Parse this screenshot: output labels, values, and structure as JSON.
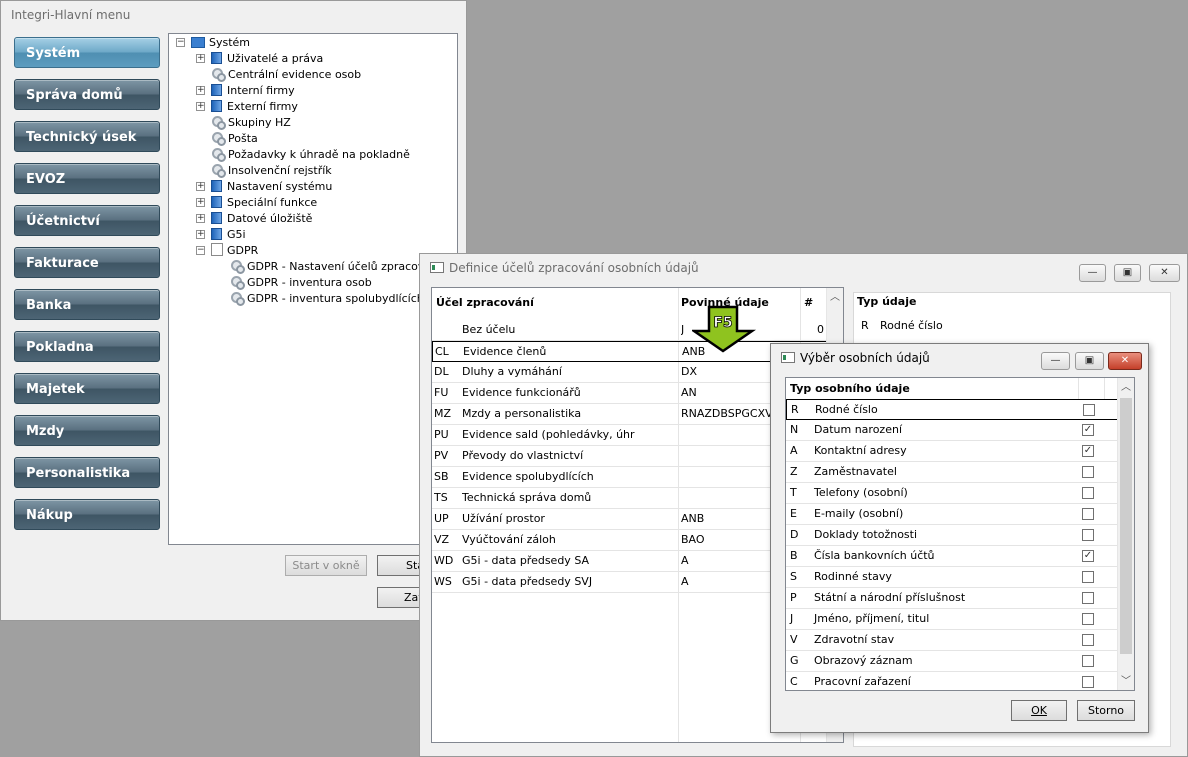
{
  "main_window": {
    "title": "Integri-Hlavní menu",
    "nav": [
      "Systém",
      "Správa domů",
      "Technický úsek",
      "EVOZ",
      "Účetnictví",
      "Fakturace",
      "Banka",
      "Pokladna",
      "Majetek",
      "Mzdy",
      "Personalistika",
      "Nákup"
    ],
    "tree": [
      {
        "label": "Systém",
        "icon": "folder-icon",
        "expander": "−"
      },
      {
        "label": "Uživatelé a práva",
        "icon": "book-icon",
        "expander": "+"
      },
      {
        "label": "Centrální evidence osob",
        "icon": "gear-icon",
        "expander": ""
      },
      {
        "label": "Interní firmy",
        "icon": "book-icon",
        "expander": "+"
      },
      {
        "label": "Externí firmy",
        "icon": "book-icon",
        "expander": "+"
      },
      {
        "label": "Skupiny HZ",
        "icon": "gear-icon",
        "expander": ""
      },
      {
        "label": "Pošta",
        "icon": "gear-icon",
        "expander": ""
      },
      {
        "label": "Požadavky k úhradě na pokladně",
        "icon": "gear-icon",
        "expander": ""
      },
      {
        "label": "Insolvenční rejstřík",
        "icon": "gear-icon",
        "expander": ""
      },
      {
        "label": "Nastavení systému",
        "icon": "book-icon",
        "expander": "+"
      },
      {
        "label": "Speciální funkce",
        "icon": "book-icon",
        "expander": "+"
      },
      {
        "label": "Datové úložiště",
        "icon": "book-icon",
        "expander": "+"
      },
      {
        "label": "G5i",
        "icon": "book-icon",
        "expander": "+"
      },
      {
        "label": "GDPR",
        "icon": "doc-icon",
        "expander": "−"
      },
      {
        "label": "GDPR - Nastavení účelů zpracování",
        "icon": "gear-icon",
        "expander": ""
      },
      {
        "label": "GDPR - inventura osob",
        "icon": "gear-icon",
        "expander": ""
      },
      {
        "label": "GDPR - inventura spolubydlících",
        "icon": "gear-icon",
        "expander": ""
      }
    ],
    "btn_start_okne": "Start v okně",
    "btn_start_partial": "Sta",
    "btn_zavrit_partial": "Zav"
  },
  "definice_window": {
    "title": "Definice účelů zpracování osobních údajů",
    "col_ucel": "Účel zpracování",
    "col_povinne": "Povinné údaje",
    "col_hash": "#",
    "rows": [
      {
        "code": "",
        "name": "Bez účelu",
        "req": "J",
        "count": "0"
      },
      {
        "code": "CL",
        "name": "Evidence členů",
        "req": "ANB",
        "count": ""
      },
      {
        "code": "DL",
        "name": "Dluhy a vymáhání",
        "req": "DX",
        "count": ""
      },
      {
        "code": "FU",
        "name": "Evidence funkcionářů",
        "req": "AN",
        "count": ""
      },
      {
        "code": "MZ",
        "name": "Mzdy a personalistika",
        "req": "RNAZDBSPGCXV",
        "count": ""
      },
      {
        "code": "PU",
        "name": "Evidence sald (pohledávky, úhr",
        "req": "",
        "count": ""
      },
      {
        "code": "PV",
        "name": "Převody do vlastnictví",
        "req": "",
        "count": ""
      },
      {
        "code": "SB",
        "name": "Evidence spolubydlících",
        "req": "",
        "count": ""
      },
      {
        "code": "TS",
        "name": "Technická správa domů",
        "req": "",
        "count": ""
      },
      {
        "code": "UP",
        "name": "Užívání prostor",
        "req": "ANB",
        "count": ""
      },
      {
        "code": "VZ",
        "name": "Vyúčtování záloh",
        "req": "BAO",
        "count": ""
      },
      {
        "code": "WD",
        "name": "G5i - data předsedy SA",
        "req": "A",
        "count": ""
      },
      {
        "code": "WS",
        "name": "G5i - data předsedy SVJ",
        "req": "A",
        "count": ""
      }
    ],
    "typ_header": "Typ údaje",
    "typ_rows": [
      {
        "code": "R",
        "label": "Rodné číslo"
      }
    ],
    "arrow_label": "F5"
  },
  "vyber_window": {
    "title": "Výběr osobních údajů",
    "header": "Typ osobního údaje",
    "rows": [
      {
        "code": "R",
        "label": "Rodné číslo",
        "checked": false
      },
      {
        "code": "N",
        "label": "Datum narození",
        "checked": true
      },
      {
        "code": "A",
        "label": "Kontaktní adresy",
        "checked": true
      },
      {
        "code": "Z",
        "label": "Zaměstnavatel",
        "checked": false
      },
      {
        "code": "T",
        "label": "Telefony (osobní)",
        "checked": false
      },
      {
        "code": "E",
        "label": "E-maily (osobní)",
        "checked": false
      },
      {
        "code": "D",
        "label": "Doklady totožnosti",
        "checked": false
      },
      {
        "code": "B",
        "label": "Čísla bankovních účtů",
        "checked": true
      },
      {
        "code": "S",
        "label": "Rodinné stavy",
        "checked": false
      },
      {
        "code": "P",
        "label": "Státní a národní příslušnost",
        "checked": false
      },
      {
        "code": "J",
        "label": "Jméno, příjmení, titul",
        "checked": false
      },
      {
        "code": "V",
        "label": "Zdravotní stav",
        "checked": false
      },
      {
        "code": "G",
        "label": "Obrazový záznam",
        "checked": false
      },
      {
        "code": "C",
        "label": "Pracovní zařazení",
        "checked": false
      }
    ],
    "ok": "OK",
    "storno": "Storno"
  },
  "colors": {
    "accent_green": "#8fc31f",
    "nav_active": "#6ea9c8",
    "nav_normal": "#5a7080"
  }
}
